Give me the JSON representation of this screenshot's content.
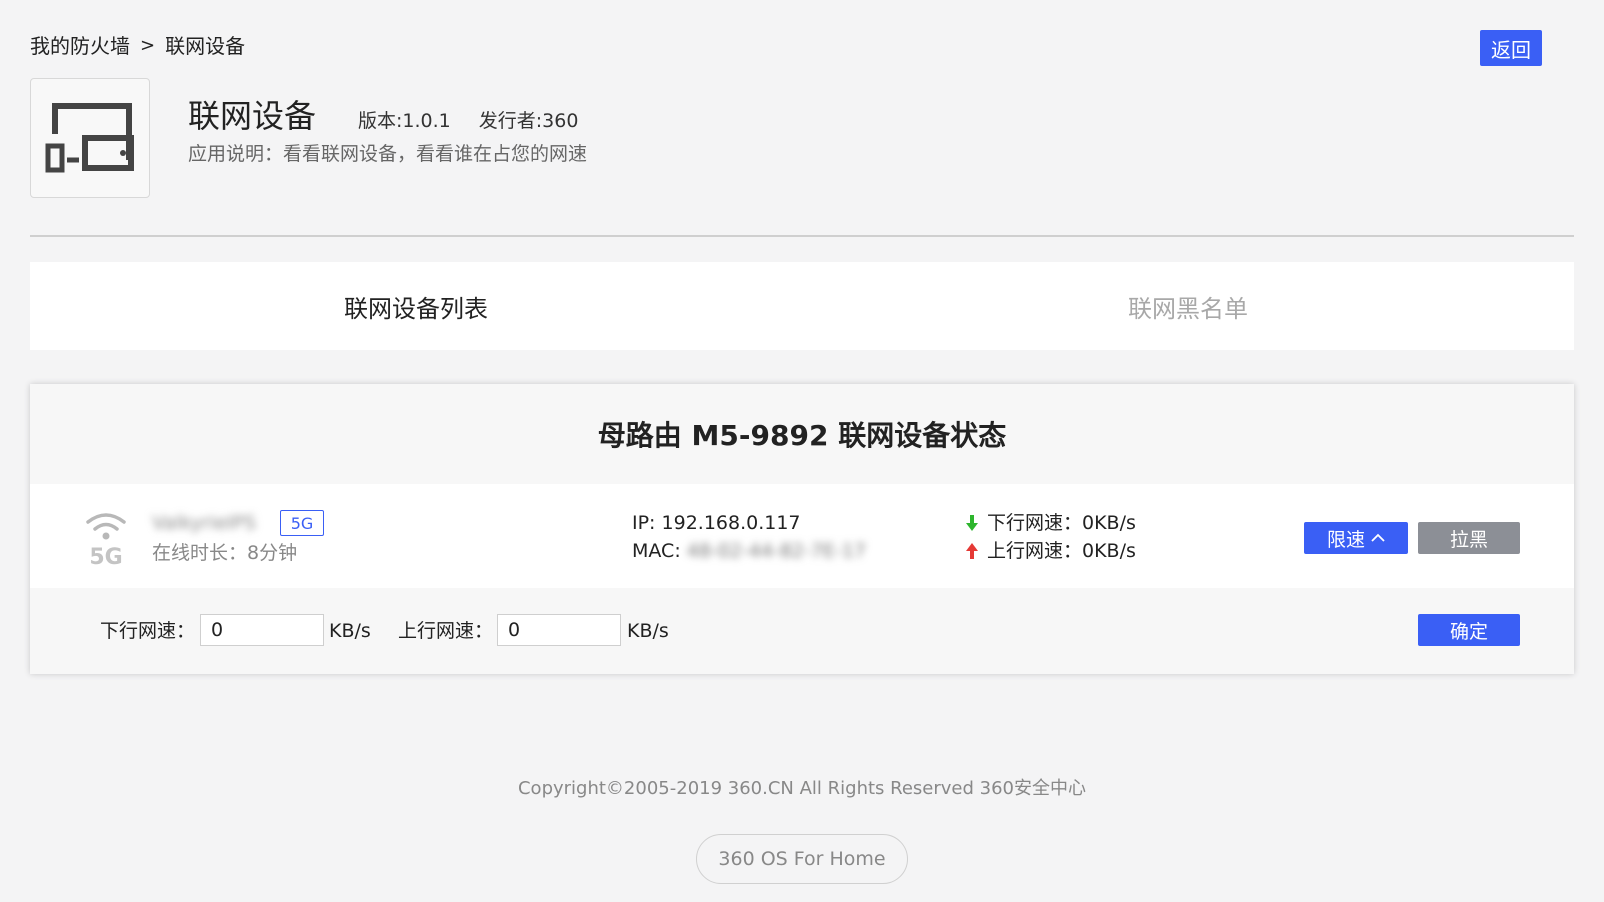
{
  "breadcrumb": {
    "parent": "我的防火墙",
    "separator": ">",
    "current": "联网设备"
  },
  "header": {
    "back_label": "返回"
  },
  "app": {
    "icon": "device-monitor-icon",
    "title": "联网设备",
    "version": "版本:1.0.1",
    "publisher": "发行者:360",
    "description": "应用说明：看看联网设备，看看谁在占您的网速"
  },
  "tabs": [
    {
      "label": "联网设备列表",
      "active": true
    },
    {
      "label": "联网黑名单",
      "active": false
    }
  ],
  "card": {
    "title": "母路由 M5-9892 联网设备状态",
    "device": {
      "icon": "wifi-5g-icon",
      "name": "ValkyrieIPS",
      "band": "5G",
      "online_time": "在线时长：8分钟",
      "ip_label": "IP:",
      "ip": "192.168.0.117",
      "mac_label": "MAC:",
      "mac": "48-02-44-82-7E-17",
      "download": "下行网速：0KB/s",
      "upload": "上行网速：0KB/s",
      "limit_label": "限速",
      "block_label": "拉黑"
    },
    "limit_form": {
      "down_label": "下行网速：",
      "down_value": "0",
      "up_label": "上行网速：",
      "up_value": "0",
      "unit": "KB/s",
      "confirm_label": "确定"
    }
  },
  "footer": {
    "copyright": "Copyright©2005-2019 360.CN All Rights Reserved 360安全中心",
    "os_badge": "360 OS For Home"
  },
  "colors": {
    "accent": "#3a5ff5",
    "muted_button": "#8c8f96",
    "download_arrow": "#2db52d",
    "upload_arrow": "#e53935"
  }
}
